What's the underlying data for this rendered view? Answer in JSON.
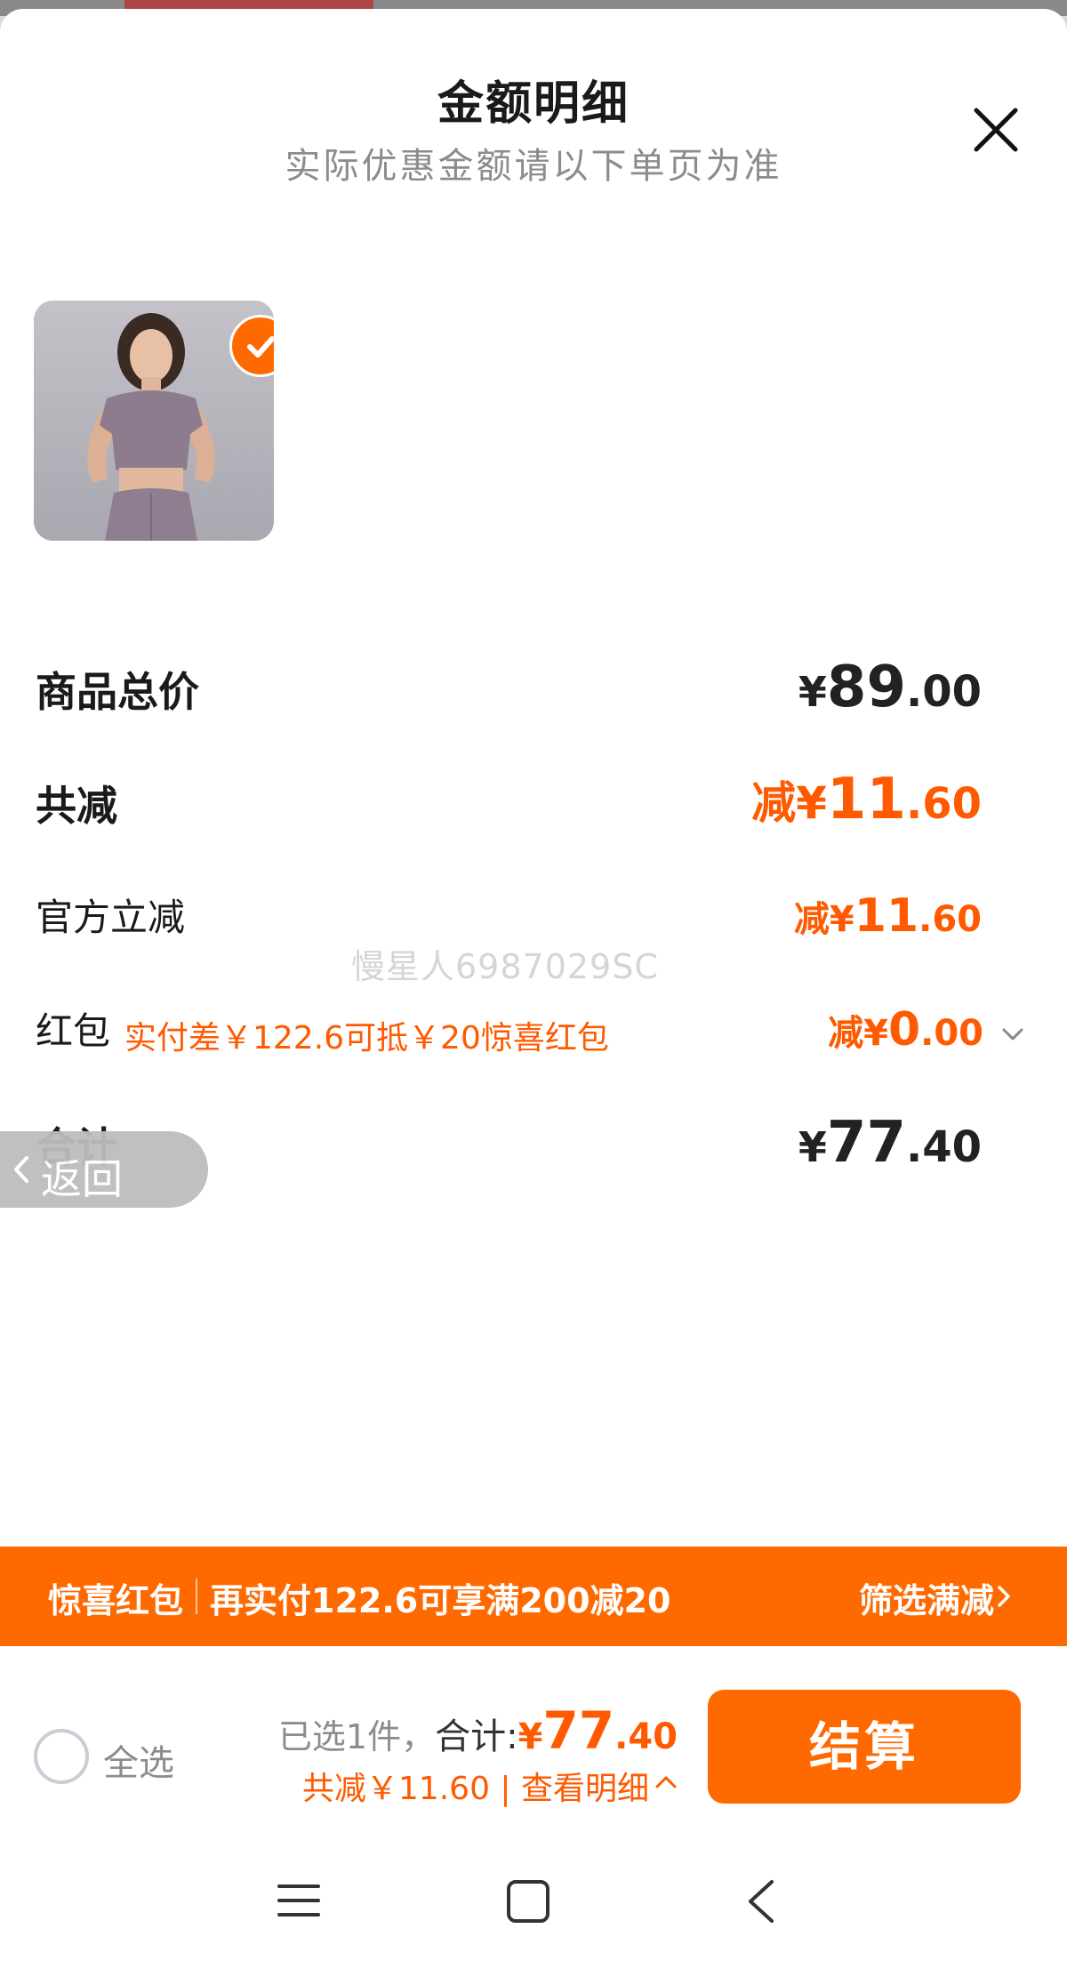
{
  "header": {
    "title": "金额明细",
    "subtitle": "实际优惠金额请以下单页为准"
  },
  "product": {
    "selected": true
  },
  "summary_rows": {
    "goods_total": {
      "label": "商品总价",
      "currency": "¥",
      "int": "89",
      "dec": ".00"
    },
    "total_discount": {
      "label": "共减",
      "prefix": "减¥",
      "int": "11",
      "dec": ".60"
    },
    "official_discount": {
      "label": "官方立减",
      "prefix": "减¥",
      "int": "11",
      "dec": ".60"
    },
    "red_packet": {
      "label": "红包",
      "hint": "实付差￥122.6可抵￥20惊喜红包",
      "prefix": "减¥",
      "int": "0",
      "dec": ".00"
    },
    "total": {
      "label": "合计",
      "currency": "¥",
      "int": "77",
      "dec": ".40"
    }
  },
  "watermark": "慢星人6987029SC",
  "back_pill": {
    "label": "返回"
  },
  "promo_bar": {
    "left": "惊喜红包",
    "middle": "再实付122.6可享满200减20",
    "right": "筛选满减"
  },
  "footer": {
    "select_all": "全选",
    "selected_count": "已选1件，",
    "total_label": "合计:",
    "total_currency": "¥",
    "total_int": "77",
    "total_dec": ".40",
    "discount_detail": "共减￥11.60 | 查看明细",
    "checkout": "结算"
  },
  "colors": {
    "accent": "#ff6a00",
    "discount_text": "#ff5a00"
  },
  "icons": [
    "close-icon",
    "check-icon",
    "chevron-down-icon",
    "chevron-left-icon",
    "chevron-right-icon",
    "chevron-up-icon",
    "menu-icon",
    "home-icon",
    "back-icon"
  ]
}
